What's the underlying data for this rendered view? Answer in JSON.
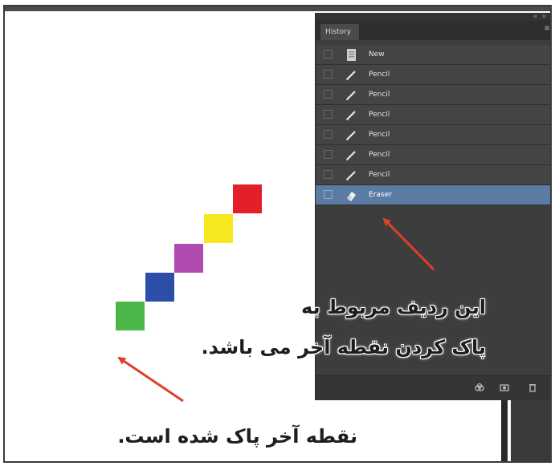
{
  "history_panel": {
    "tab_label": "History",
    "collapse_glyph": "« ×",
    "menu_glyph": "≡",
    "rows": [
      {
        "label": "New",
        "icon": "document-icon",
        "active": false
      },
      {
        "label": "Pencil",
        "icon": "pencil-icon",
        "active": false
      },
      {
        "label": "Pencil",
        "icon": "pencil-icon",
        "active": false
      },
      {
        "label": "Pencil",
        "icon": "pencil-icon",
        "active": false
      },
      {
        "label": "Pencil",
        "icon": "pencil-icon",
        "active": false
      },
      {
        "label": "Pencil",
        "icon": "pencil-icon",
        "active": false
      },
      {
        "label": "Pencil",
        "icon": "pencil-icon",
        "active": false
      },
      {
        "label": "Eraser",
        "icon": "eraser-icon",
        "active": true
      }
    ],
    "bottom_icons": [
      "new-document-from-state-icon",
      "create-snapshot-icon",
      "delete-state-icon"
    ]
  },
  "canvas": {
    "squares": [
      {
        "name": "green-square",
        "color": "#4cb748"
      },
      {
        "name": "blue-square",
        "color": "#2d4ea8"
      },
      {
        "name": "purple-square",
        "color": "#b04bb0"
      },
      {
        "name": "yellow-square",
        "color": "#f6e71e"
      },
      {
        "name": "red-square",
        "color": "#e3202a"
      }
    ]
  },
  "annotations": {
    "callout_row": {
      "line1": "این ردیف مربوط به",
      "line2": "پاک کردن نقطه آخر می باشد."
    },
    "callout_point": "نقطه آخر پاک شده است.",
    "arrow_color": "#e0402a"
  },
  "colors": {
    "panel_bg": "#3d3d3d",
    "active_row": "#5b7ba3"
  }
}
